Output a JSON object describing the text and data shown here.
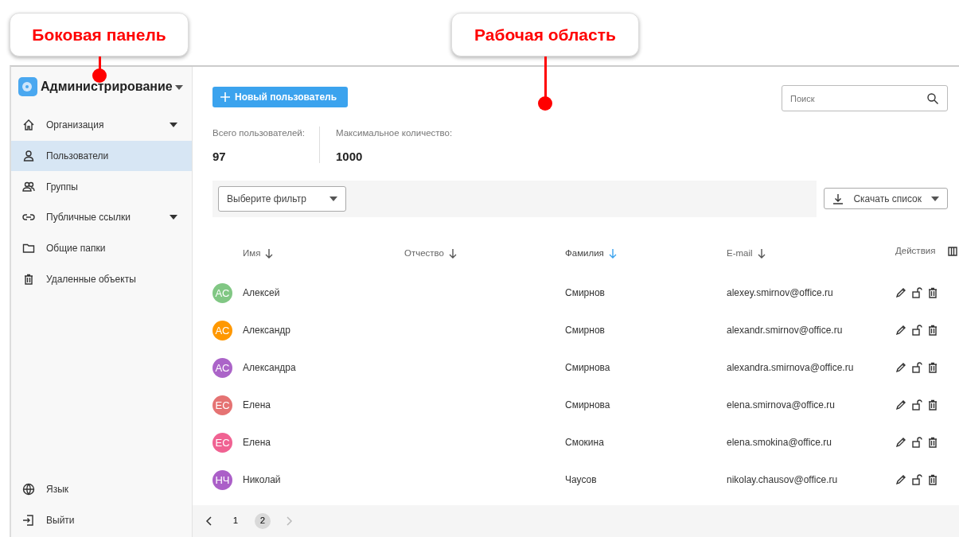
{
  "annotations": [
    {
      "label": "Боковая панель"
    },
    {
      "label": "Рабочая область"
    }
  ],
  "sidebar": {
    "title": "Администрирование",
    "items": [
      {
        "label": "Организация",
        "has_submenu": true,
        "selected": false
      },
      {
        "label": "Пользователи",
        "has_submenu": false,
        "selected": true
      },
      {
        "label": "Группы",
        "has_submenu": false,
        "selected": false
      },
      {
        "label": "Публичные ссылки",
        "has_submenu": true,
        "selected": false
      },
      {
        "label": "Общие папки",
        "has_submenu": false,
        "selected": false
      },
      {
        "label": "Удаленные объекты",
        "has_submenu": false,
        "selected": false
      }
    ],
    "bottom_items": [
      {
        "label": "Язык"
      },
      {
        "label": "Выйти"
      }
    ]
  },
  "new_user_button": "Новый пользователь",
  "search": {
    "placeholder": "Поиск"
  },
  "stats": [
    {
      "label": "Всего пользователей:",
      "value": "97"
    },
    {
      "label": "Максимальное количество:",
      "value": "1000"
    }
  ],
  "filter": {
    "placeholder": "Выберите фильтр"
  },
  "download_button": "Скачать список",
  "table": {
    "columns": [
      {
        "label": "Имя",
        "sortable": true,
        "sort_active": false
      },
      {
        "label": "Отчество",
        "sortable": true,
        "sort_active": false
      },
      {
        "label": "Фамилия",
        "sortable": true,
        "sort_active": true
      },
      {
        "label": "E-mail",
        "sortable": true,
        "sort_active": false
      },
      {
        "label": "Действия",
        "sortable": false
      }
    ],
    "rows": [
      {
        "initials": "АС",
        "color": "#81c784",
        "first_name": "Алексей",
        "last_name": "Смирнов",
        "email": "alexey.smirnov@office.ru"
      },
      {
        "initials": "АС",
        "color": "#ff9800",
        "first_name": "Александр",
        "last_name": "Смирнов",
        "email": "alexandr.smirnov@office.ru"
      },
      {
        "initials": "АС",
        "color": "#ab64c8",
        "first_name": "Александра",
        "last_name": "Смирнова",
        "email": "alexandra.smirnova@office.ru"
      },
      {
        "initials": "ЕС",
        "color": "#e57373",
        "first_name": "Елена",
        "last_name": "Смирнова",
        "email": "elena.smirnova@office.ru"
      },
      {
        "initials": "ЕС",
        "color": "#f06292",
        "first_name": "Елена",
        "last_name": "Смокина",
        "email": "elena.smokina@office.ru"
      },
      {
        "initials": "НЧ",
        "color": "#ab5fc8",
        "first_name": "Николай",
        "last_name": "Чаусов",
        "email": "nikolay.chausov@office.ru"
      }
    ]
  },
  "pagination": {
    "prev_disabled": false,
    "next_disabled": true,
    "pages": [
      {
        "label": "1",
        "selected": false
      },
      {
        "label": "2",
        "selected": true
      }
    ]
  }
}
